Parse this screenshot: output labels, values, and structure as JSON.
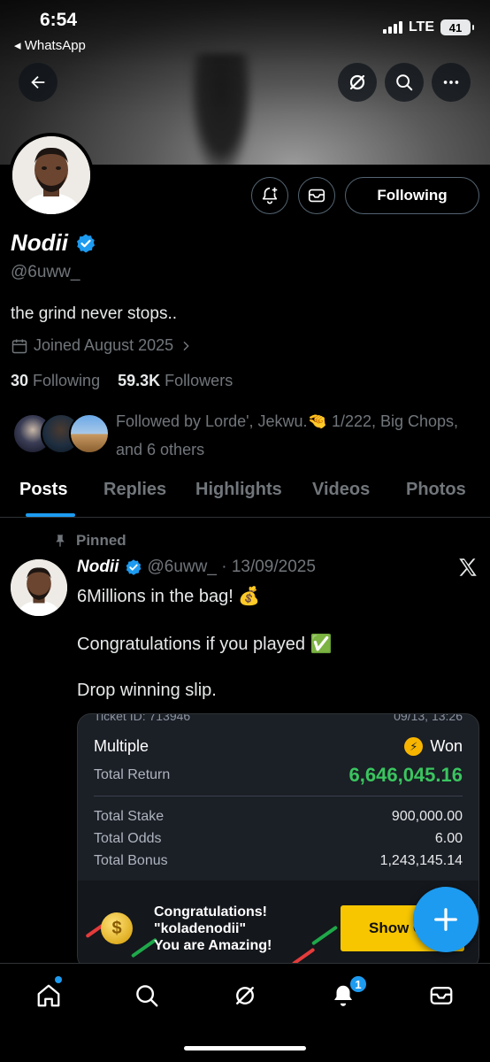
{
  "status_bar": {
    "time": "6:54",
    "back_app": "◂ WhatsApp",
    "network": "LTE",
    "battery": "41"
  },
  "profile": {
    "name": "Nodii",
    "handle": "@6uww_",
    "bio": "the grind never stops..",
    "joined": "Joined August 2025",
    "following_count": "30",
    "following_label": "Following",
    "followers_count": "59.3K",
    "followers_label": "Followers",
    "followed_by": "Followed by Lorde', Jekwu.🤏 1/222, Big Chops, and 6 others",
    "follow_button": "Following"
  },
  "tabs": [
    "Posts",
    "Replies",
    "Highlights",
    "Videos",
    "Photos"
  ],
  "post": {
    "pinned_label": "Pinned",
    "author": "Nodii",
    "handle_date": "@6uww_ · 13/09/2025",
    "line1": "6Millions in the bag! 💰",
    "line2": "Congratulations if you played ✅",
    "line3": "Drop winning slip."
  },
  "slip": {
    "ticket_id": "Ticket ID: 713946",
    "ticket_date": "09/13, 13:26",
    "type": "Multiple",
    "status": "Won",
    "total_return_label": "Total Return",
    "total_return": "6,646,045.16",
    "total_stake_label": "Total Stake",
    "total_stake": "900,000.00",
    "total_odds_label": "Total Odds",
    "total_odds": "6.00",
    "total_bonus_label": "Total Bonus",
    "total_bonus": "1,243,145.14",
    "congrats_line1": "Congratulations!",
    "congrats_line2": "\"koladenodii\"",
    "congrats_line3": "You are Amazing!",
    "show_button": "Show C"
  },
  "nav": {
    "notifications_badge": "1"
  },
  "colors": {
    "accent": "#1d9bf0",
    "won_green": "#3ac55f",
    "button_yellow": "#f7c600"
  }
}
